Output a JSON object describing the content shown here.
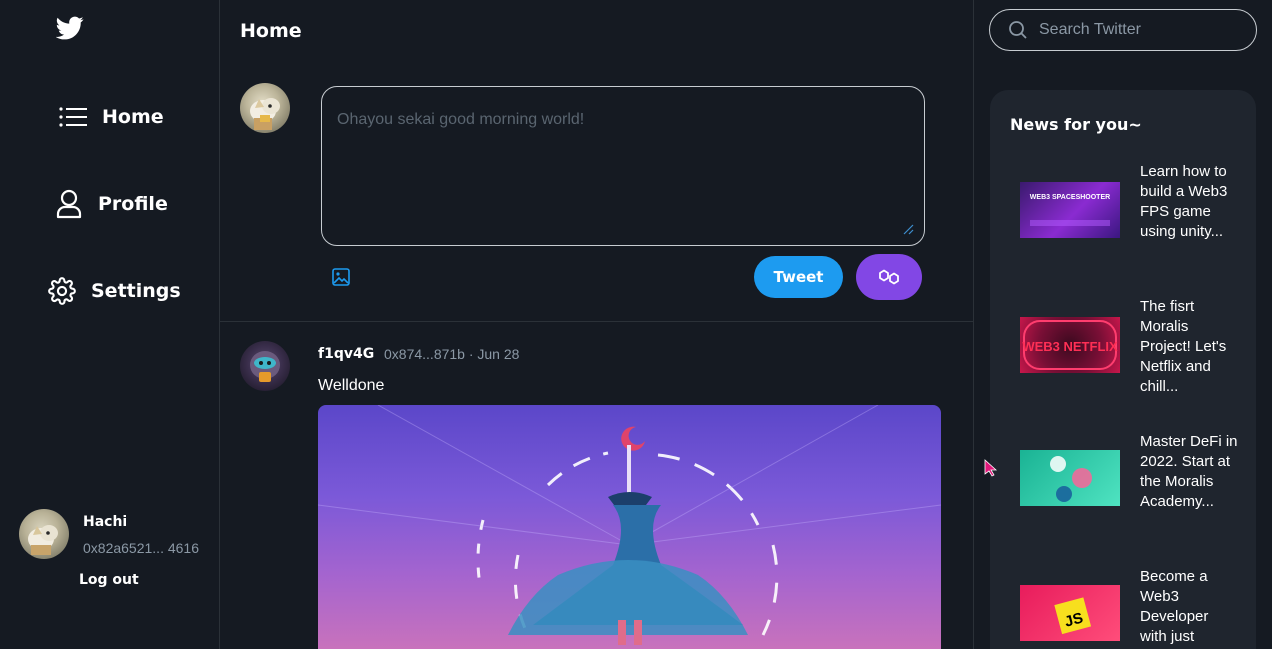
{
  "sidebar": {
    "nav": [
      {
        "label": "Home",
        "icon": "list-icon"
      },
      {
        "label": "Profile",
        "icon": "user-icon"
      },
      {
        "label": "Settings",
        "icon": "gear-icon"
      }
    ],
    "user": {
      "name": "Hachi",
      "address": "0x82a6521... 4616",
      "logout_label": "Log out"
    }
  },
  "main": {
    "title": "Home",
    "compose": {
      "placeholder": "Ohayou sekai good morning world!",
      "tweet_label": "Tweet"
    },
    "post": {
      "author": "f1qv4G",
      "meta": "0x874...871b · Jun 28",
      "text": "Welldone"
    }
  },
  "right": {
    "search_placeholder": "Search Twitter",
    "news_title": "News for you~",
    "news": [
      {
        "text": "Learn how to build a Web3 FPS game using unity...",
        "thumb_text": "WEB3 SPACESHOOTER"
      },
      {
        "text": "The fisrt Moralis Project! Let's Netflix and chill...",
        "thumb_text": "WEB3 NETFLIX"
      },
      {
        "text": "Master DeFi in 2022. Start at the Moralis Academy...",
        "thumb_text": ""
      },
      {
        "text": "Become a Web3 Developer with just",
        "thumb_text": "JS"
      }
    ]
  },
  "colors": {
    "background": "#151a22",
    "panel": "#1f252e",
    "accent": "#1d9bf0",
    "polygon": "#8247e5"
  }
}
